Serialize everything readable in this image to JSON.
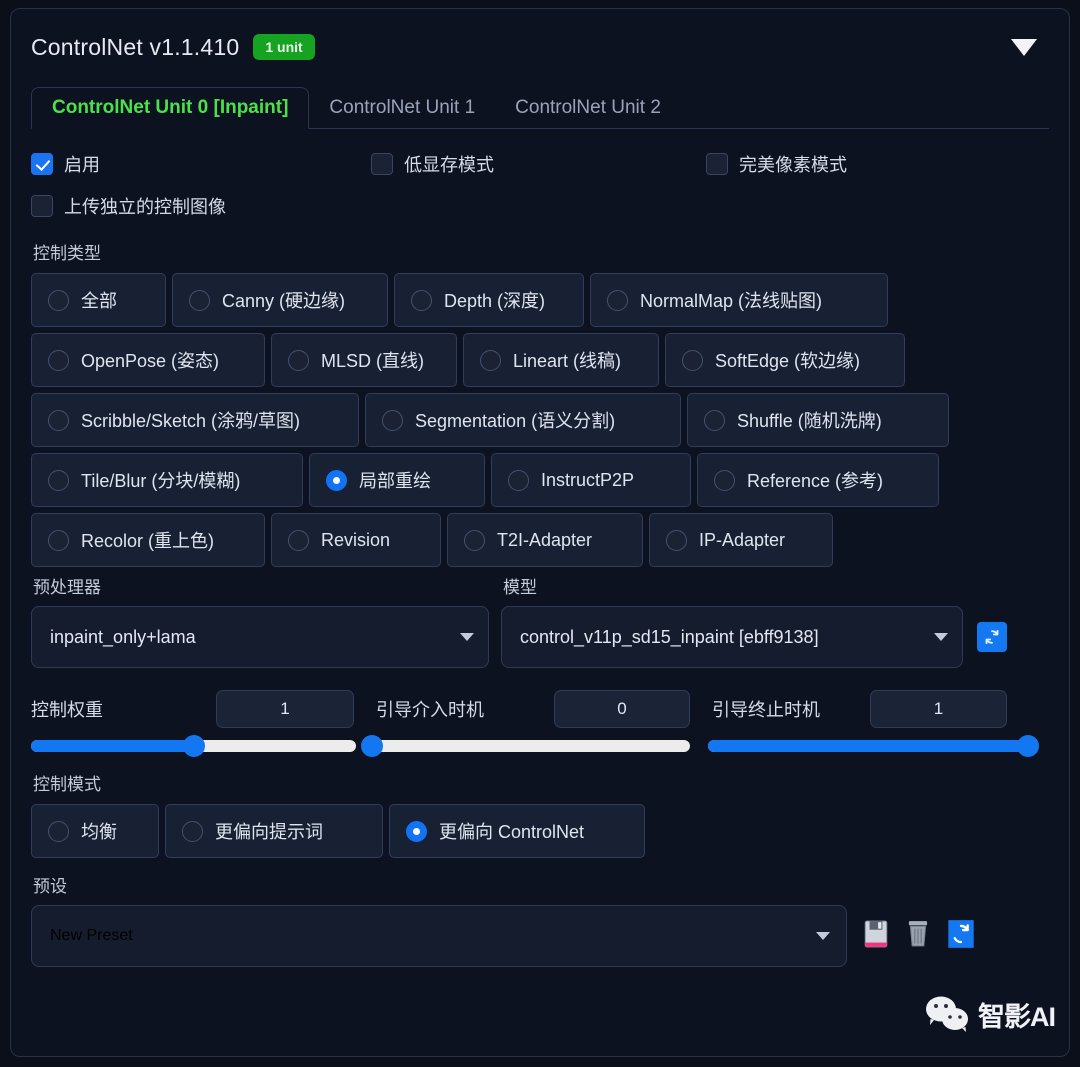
{
  "header": {
    "title": "ControlNet v1.1.410",
    "badge": "1 unit",
    "collapse_icon": "chevron-down-icon"
  },
  "tabs": [
    {
      "label": "ControlNet Unit 0 [Inpaint]",
      "active": true
    },
    {
      "label": "ControlNet Unit 1",
      "active": false
    },
    {
      "label": "ControlNet Unit 2",
      "active": false
    }
  ],
  "checkboxes": {
    "enable": {
      "label": "启用",
      "checked": true
    },
    "low_vram": {
      "label": "低显存模式",
      "checked": false
    },
    "pixel_perfect": {
      "label": "完美像素模式",
      "checked": false
    },
    "upload_independent": {
      "label": "上传独立的控制图像",
      "checked": false
    }
  },
  "control_type": {
    "label": "控制类型",
    "rows": [
      [
        {
          "label": "全部",
          "selected": false
        },
        {
          "label": "Canny (硬边缘)",
          "selected": false
        },
        {
          "label": "Depth (深度)",
          "selected": false
        },
        {
          "label": "NormalMap (法线贴图)",
          "selected": false
        }
      ],
      [
        {
          "label": "OpenPose (姿态)",
          "selected": false
        },
        {
          "label": "MLSD (直线)",
          "selected": false
        },
        {
          "label": "Lineart (线稿)",
          "selected": false
        },
        {
          "label": "SoftEdge (软边缘)",
          "selected": false
        }
      ],
      [
        {
          "label": "Scribble/Sketch (涂鸦/草图)",
          "selected": false
        },
        {
          "label": "Segmentation (语义分割)",
          "selected": false
        },
        {
          "label": "Shuffle (随机洗牌)",
          "selected": false
        }
      ],
      [
        {
          "label": "Tile/Blur (分块/模糊)",
          "selected": false
        },
        {
          "label": "局部重绘",
          "selected": true
        },
        {
          "label": "InstructP2P",
          "selected": false
        },
        {
          "label": "Reference (参考)",
          "selected": false
        }
      ],
      [
        {
          "label": "Recolor (重上色)",
          "selected": false
        },
        {
          "label": "Revision",
          "selected": false
        },
        {
          "label": "T2I-Adapter",
          "selected": false
        },
        {
          "label": "IP-Adapter",
          "selected": false
        }
      ]
    ]
  },
  "preprocessor": {
    "label": "预处理器",
    "value": "inpaint_only+lama",
    "caret_icon": "chevron-down-icon"
  },
  "model": {
    "label": "模型",
    "value": "control_v11p_sd15_inpaint [ebff9138]",
    "caret_icon": "chevron-down-icon",
    "refresh_icon": "refresh-icon"
  },
  "sliders": [
    {
      "label": "控制权重",
      "value": "1",
      "percent": 50
    },
    {
      "label": "引导介入时机",
      "value": "0",
      "percent": 0
    },
    {
      "label": "引导终止时机",
      "value": "1",
      "percent": 100
    }
  ],
  "control_mode": {
    "label": "控制模式",
    "options": [
      {
        "label": "均衡",
        "selected": false
      },
      {
        "label": "更偏向提示词",
        "selected": false
      },
      {
        "label": "更偏向 ControlNet",
        "selected": true
      }
    ]
  },
  "preset": {
    "label": "预设",
    "value": "New Preset",
    "caret_icon": "chevron-down-icon",
    "save_icon": "floppy-save-icon",
    "delete_icon": "trash-icon",
    "refresh_icon": "refresh-icon"
  },
  "watermark": {
    "logo_icon": "wechat-icon",
    "text": "智影AI"
  },
  "colors": {
    "accent_blue": "#1477f2",
    "badge_green": "#16a321",
    "active_tab_green": "#4ce04c",
    "panel_bg": "#0d1220"
  }
}
